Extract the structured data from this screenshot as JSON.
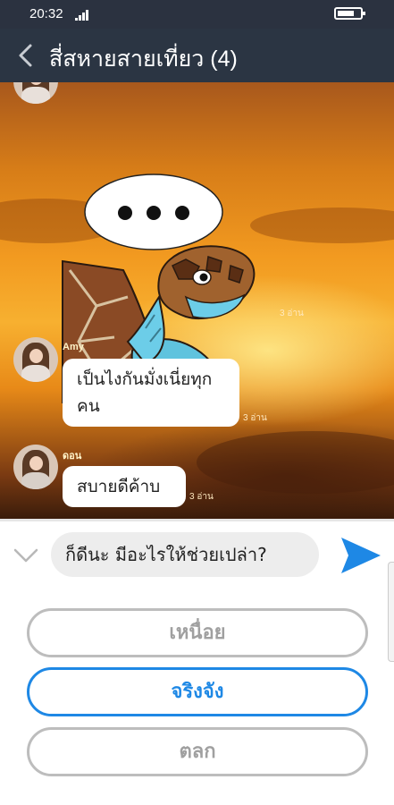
{
  "status_bar": {
    "time": "20:32"
  },
  "header": {
    "title": "สี่สหายสายเที่ยว (4)"
  },
  "messages": [
    {
      "type": "sticker",
      "sticker_icon": "sea-turtle-thinking-sticker",
      "read": "3 อ่าน"
    },
    {
      "type": "text",
      "sender": "Amy",
      "text_line1": "เป็นไงกันมั่งเนี่ยทุก",
      "text_line2": "คน",
      "read": "3 อ่าน"
    },
    {
      "type": "text",
      "sender": "ดอน",
      "text": "สบายดีค้าบ",
      "read": "3 อ่าน"
    }
  ],
  "input": {
    "value": "ก็ดีนะ มีอะไรให้ช่วยเปล่า?"
  },
  "options": [
    "เหนื่อย",
    "จริงจัง",
    "ตลก"
  ],
  "colors": {
    "header": "#2b3543",
    "accent": "#1e88e5",
    "muted": "#bdbdbd"
  }
}
